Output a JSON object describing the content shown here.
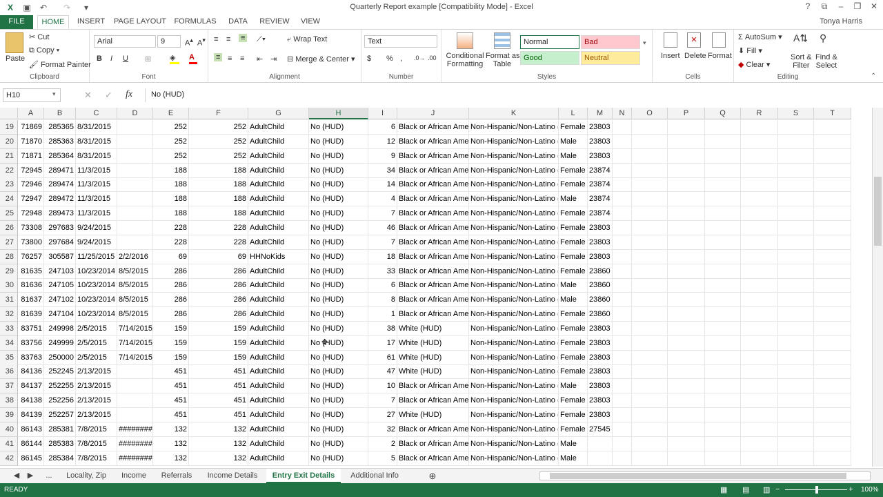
{
  "window": {
    "title": "Quarterly Report example  [Compatibility Mode] - Excel",
    "user": "Tonya Harris"
  },
  "tabs": [
    "FILE",
    "HOME",
    "INSERT",
    "PAGE LAYOUT",
    "FORMULAS",
    "DATA",
    "REVIEW",
    "VIEW"
  ],
  "ribbon": {
    "clipboard": {
      "paste": "Paste",
      "cut": "Cut",
      "copy": "Copy",
      "format_painter": "Format Painter",
      "label": "Clipboard"
    },
    "font": {
      "name": "Arial",
      "size": "9",
      "bold": "B",
      "italic": "I",
      "underline": "U",
      "label": "Font"
    },
    "alignment": {
      "wrap": "Wrap Text",
      "merge": "Merge & Center",
      "label": "Alignment"
    },
    "number": {
      "format": "Text",
      "currency": "$",
      "percent": "%",
      "comma": ",",
      "label": "Number"
    },
    "styles": {
      "conditional": "Conditional",
      "formatting": "Formatting",
      "format_as": "Format as",
      "table": "Table",
      "normal": "Normal",
      "bad": "Bad",
      "good": "Good",
      "neutral": "Neutral",
      "label": "Styles"
    },
    "cells": {
      "insert": "Insert",
      "delete": "Delete",
      "format": "Format",
      "label": "Cells"
    },
    "editing": {
      "autosum": "AutoSum",
      "fill": "Fill",
      "clear": "Clear",
      "sort": "Sort &",
      "filter": "Filter",
      "find": "Find &",
      "select": "Select",
      "label": "Editing"
    }
  },
  "formula_bar": {
    "name_box": "H10",
    "fx": "fx",
    "value": "No (HUD)"
  },
  "columns": [
    "A",
    "B",
    "C",
    "D",
    "E",
    "F",
    "G",
    "H",
    "I",
    "J",
    "K",
    "L",
    "M",
    "N",
    "O",
    "P",
    "Q",
    "R",
    "S",
    "T"
  ],
  "rows": [
    {
      "n": "19",
      "a": "71869",
      "b": "285365",
      "c": "8/31/2015",
      "d": "",
      "e": "252",
      "f": "252",
      "g": "AdultChild",
      "h": "No (HUD)",
      "i": "6",
      "j": "Black or African Americ",
      "k": "Non-Hispanic/Non-Latino (H",
      "l": "Female",
      "m": "23803"
    },
    {
      "n": "20",
      "a": "71870",
      "b": "285363",
      "c": "8/31/2015",
      "d": "",
      "e": "252",
      "f": "252",
      "g": "AdultChild",
      "h": "No (HUD)",
      "i": "12",
      "j": "Black or African Americ",
      "k": "Non-Hispanic/Non-Latino (H",
      "l": "Male",
      "m": "23803"
    },
    {
      "n": "21",
      "a": "71871",
      "b": "285364",
      "c": "8/31/2015",
      "d": "",
      "e": "252",
      "f": "252",
      "g": "AdultChild",
      "h": "No (HUD)",
      "i": "9",
      "j": "Black or African Americ",
      "k": "Non-Hispanic/Non-Latino (H",
      "l": "Male",
      "m": "23803"
    },
    {
      "n": "22",
      "a": "72945",
      "b": "289471",
      "c": "11/3/2015",
      "d": "",
      "e": "188",
      "f": "188",
      "g": "AdultChild",
      "h": "No (HUD)",
      "i": "34",
      "j": "Black or African Americ",
      "k": "Non-Hispanic/Non-Latino (H",
      "l": "Female",
      "m": "23874"
    },
    {
      "n": "23",
      "a": "72946",
      "b": "289474",
      "c": "11/3/2015",
      "d": "",
      "e": "188",
      "f": "188",
      "g": "AdultChild",
      "h": "No (HUD)",
      "i": "14",
      "j": "Black or African Americ",
      "k": "Non-Hispanic/Non-Latino (H",
      "l": "Female",
      "m": "23874"
    },
    {
      "n": "24",
      "a": "72947",
      "b": "289472",
      "c": "11/3/2015",
      "d": "",
      "e": "188",
      "f": "188",
      "g": "AdultChild",
      "h": "No (HUD)",
      "i": "4",
      "j": "Black or African Americ",
      "k": "Non-Hispanic/Non-Latino (H",
      "l": "Male",
      "m": "23874"
    },
    {
      "n": "25",
      "a": "72948",
      "b": "289473",
      "c": "11/3/2015",
      "d": "",
      "e": "188",
      "f": "188",
      "g": "AdultChild",
      "h": "No (HUD)",
      "i": "7",
      "j": "Black or African Americ",
      "k": "Non-Hispanic/Non-Latino (H",
      "l": "Female",
      "m": "23874"
    },
    {
      "n": "26",
      "a": "73308",
      "b": "297683",
      "c": "9/24/2015",
      "d": "",
      "e": "228",
      "f": "228",
      "g": "AdultChild",
      "h": "No (HUD)",
      "i": "46",
      "j": "Black or African Americ",
      "k": "Non-Hispanic/Non-Latino (H",
      "l": "Female",
      "m": "23803"
    },
    {
      "n": "27",
      "a": "73800",
      "b": "297684",
      "c": "9/24/2015",
      "d": "",
      "e": "228",
      "f": "228",
      "g": "AdultChild",
      "h": "No (HUD)",
      "i": "7",
      "j": "Black or African Americ",
      "k": "Non-Hispanic/Non-Latino (H",
      "l": "Female",
      "m": "23803"
    },
    {
      "n": "28",
      "a": "76257",
      "b": "305587",
      "c": "11/25/2015",
      "d": "2/2/2016",
      "e": "69",
      "f": "69",
      "g": "HHNoKids",
      "h": "No (HUD)",
      "i": "18",
      "j": "Black or African Americ",
      "k": "Non-Hispanic/Non-Latino (H",
      "l": "Female",
      "m": "23803"
    },
    {
      "n": "29",
      "a": "81635",
      "b": "247103",
      "c": "10/23/2014",
      "d": "8/5/2015",
      "e": "286",
      "f": "286",
      "g": "AdultChild",
      "h": "No (HUD)",
      "i": "33",
      "j": "Black or African Americ",
      "k": "Non-Hispanic/Non-Latino (H",
      "l": "Female",
      "m": "23860"
    },
    {
      "n": "30",
      "a": "81636",
      "b": "247105",
      "c": "10/23/2014",
      "d": "8/5/2015",
      "e": "286",
      "f": "286",
      "g": "AdultChild",
      "h": "No (HUD)",
      "i": "6",
      "j": "Black or African Americ",
      "k": "Non-Hispanic/Non-Latino (H",
      "l": "Male",
      "m": "23860"
    },
    {
      "n": "31",
      "a": "81637",
      "b": "247102",
      "c": "10/23/2014",
      "d": "8/5/2015",
      "e": "286",
      "f": "286",
      "g": "AdultChild",
      "h": "No (HUD)",
      "i": "8",
      "j": "Black or African Americ",
      "k": "Non-Hispanic/Non-Latino (H",
      "l": "Male",
      "m": "23860"
    },
    {
      "n": "32",
      "a": "81639",
      "b": "247104",
      "c": "10/23/2014",
      "d": "8/5/2015",
      "e": "286",
      "f": "286",
      "g": "AdultChild",
      "h": "No (HUD)",
      "i": "1",
      "j": "Black or African Americ",
      "k": "Non-Hispanic/Non-Latino (H",
      "l": "Female",
      "m": "23860"
    },
    {
      "n": "33",
      "a": "83751",
      "b": "249998",
      "c": "2/5/2015",
      "d": "7/14/2015",
      "e": "159",
      "f": "159",
      "g": "AdultChild",
      "h": "No (HUD)",
      "i": "38",
      "j": "White (HUD)",
      "k": "Non-Hispanic/Non-Latino (H",
      "l": "Female",
      "m": "23803"
    },
    {
      "n": "34",
      "a": "83756",
      "b": "249999",
      "c": "2/5/2015",
      "d": "7/14/2015",
      "e": "159",
      "f": "159",
      "g": "AdultChild",
      "h": "No (HUD)",
      "i": "17",
      "j": "White (HUD)",
      "k": "Non-Hispanic/Non-Latino (H",
      "l": "Female",
      "m": "23803"
    },
    {
      "n": "35",
      "a": "83763",
      "b": "250000",
      "c": "2/5/2015",
      "d": "7/14/2015",
      "e": "159",
      "f": "159",
      "g": "AdultChild",
      "h": "No (HUD)",
      "i": "61",
      "j": "White (HUD)",
      "k": "Non-Hispanic/Non-Latino (H",
      "l": "Female",
      "m": "23803"
    },
    {
      "n": "36",
      "a": "84136",
      "b": "252245",
      "c": "2/13/2015",
      "d": "",
      "e": "451",
      "f": "451",
      "g": "AdultChild",
      "h": "No (HUD)",
      "i": "47",
      "j": "White (HUD)",
      "k": "Non-Hispanic/Non-Latino (H",
      "l": "Female",
      "m": "23803"
    },
    {
      "n": "37",
      "a": "84137",
      "b": "252255",
      "c": "2/13/2015",
      "d": "",
      "e": "451",
      "f": "451",
      "g": "AdultChild",
      "h": "No (HUD)",
      "i": "10",
      "j": "Black or African Americ",
      "k": "Non-Hispanic/Non-Latino (H",
      "l": "Male",
      "m": "23803"
    },
    {
      "n": "38",
      "a": "84138",
      "b": "252256",
      "c": "2/13/2015",
      "d": "",
      "e": "451",
      "f": "451",
      "g": "AdultChild",
      "h": "No (HUD)",
      "i": "7",
      "j": "Black or African Americ",
      "k": "Non-Hispanic/Non-Latino (H",
      "l": "Female",
      "m": "23803"
    },
    {
      "n": "39",
      "a": "84139",
      "b": "252257",
      "c": "2/13/2015",
      "d": "",
      "e": "451",
      "f": "451",
      "g": "AdultChild",
      "h": "No (HUD)",
      "i": "27",
      "j": "White (HUD)",
      "k": "Non-Hispanic/Non-Latino (H",
      "l": "Female",
      "m": "23803"
    },
    {
      "n": "40",
      "a": "86143",
      "b": "285381",
      "c": "7/8/2015",
      "d": "########",
      "e": "132",
      "f": "132",
      "g": "AdultChild",
      "h": "No (HUD)",
      "i": "32",
      "j": "Black or African Americ",
      "k": "Non-Hispanic/Non-Latino (H",
      "l": "Female",
      "m": "27545"
    },
    {
      "n": "41",
      "a": "86144",
      "b": "285383",
      "c": "7/8/2015",
      "d": "########",
      "e": "132",
      "f": "132",
      "g": "AdultChild",
      "h": "No (HUD)",
      "i": "2",
      "j": "Black or African Americ",
      "k": "Non-Hispanic/Non-Latino (H",
      "l": "Male",
      "m": ""
    },
    {
      "n": "42",
      "a": "86145",
      "b": "285384",
      "c": "7/8/2015",
      "d": "########",
      "e": "132",
      "f": "132",
      "g": "AdultChild",
      "h": "No (HUD)",
      "i": "5",
      "j": "Black or African Americ",
      "k": "Non-Hispanic/Non-Latino (H",
      "l": "Male",
      "m": ""
    }
  ],
  "sheet_tabs": [
    "...",
    "Locality, Zip",
    "Income",
    "Referrals",
    "Income Details",
    "Entry Exit Details",
    "Additional Info"
  ],
  "active_sheet": "Entry Exit Details",
  "status": {
    "ready": "READY",
    "zoom": "100%"
  },
  "colors": {
    "excel_green": "#217346",
    "bad_bg": "#ffc7ce",
    "bad_fg": "#9c0006",
    "good_bg": "#c6efce",
    "good_fg": "#006100",
    "neutral_bg": "#ffeb9c",
    "neutral_fg": "#9c5700"
  }
}
